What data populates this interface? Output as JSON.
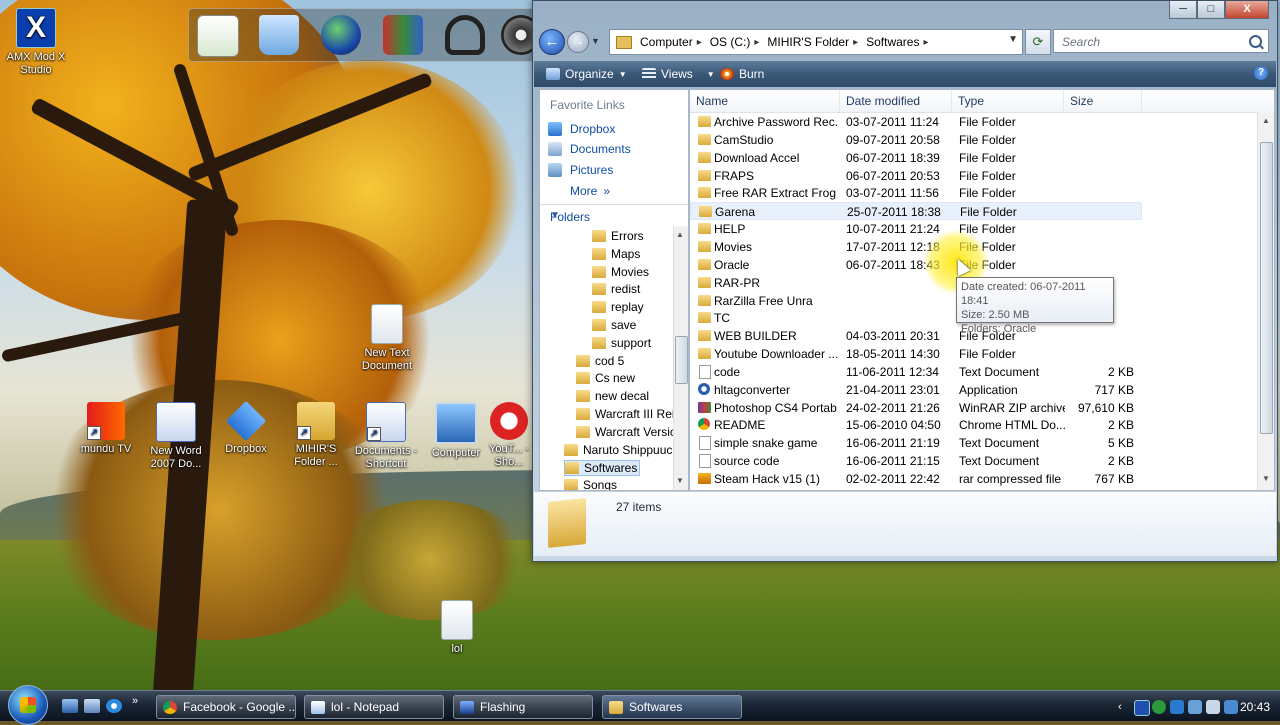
{
  "desktop": {
    "icons": [
      {
        "id": "amx",
        "label": "AMX Mod X Studio",
        "icon": "amx-icon"
      },
      {
        "id": "newtext",
        "label": "New Text Document",
        "icon": "text-file-icon"
      },
      {
        "id": "mundu",
        "label": "mundu TV",
        "icon": "mundu-icon"
      },
      {
        "id": "word",
        "label": "New Word 2007 Do...",
        "icon": "word-doc-icon"
      },
      {
        "id": "dropbox",
        "label": "Dropbox",
        "icon": "dropbox-icon"
      },
      {
        "id": "mihir",
        "label": "MIHIR'S Folder ...",
        "icon": "folder-shortcut-icon"
      },
      {
        "id": "docs",
        "label": "Documents - Shortcut",
        "icon": "documents-shortcut-icon"
      },
      {
        "id": "computer",
        "label": "Computer",
        "icon": "computer-icon"
      },
      {
        "id": "youtube",
        "label": "YouT... - Sho...",
        "icon": "youtube-shortcut-icon"
      },
      {
        "id": "lol",
        "label": "lol",
        "icon": "text-file-icon"
      }
    ]
  },
  "window": {
    "controls": {
      "minimize": "─",
      "maximize": "□",
      "close": "X"
    },
    "nav": {
      "back": "←",
      "forward": "→"
    },
    "breadcrumbs": [
      "Computer",
      "OS (C:)",
      "MIHIR'S Folder",
      "Softwares"
    ],
    "search_placeholder": "Search",
    "toolbar": {
      "organize": "Organize",
      "views": "Views",
      "burn": "Burn",
      "help": "?"
    },
    "favorites": {
      "title": "Favorite Links",
      "items": [
        {
          "label": "Dropbox",
          "icon": "dropbox-icon"
        },
        {
          "label": "Documents",
          "icon": "documents-icon"
        },
        {
          "label": "Pictures",
          "icon": "pictures-icon"
        },
        {
          "label": "More",
          "icon": "more-chevron-icon"
        }
      ]
    },
    "folders_header": "Folders",
    "tree": [
      {
        "label": "Errors",
        "level": 3
      },
      {
        "label": "Maps",
        "level": 3
      },
      {
        "label": "Movies",
        "level": 3
      },
      {
        "label": "redist",
        "level": 3
      },
      {
        "label": "replay",
        "level": 3
      },
      {
        "label": "save",
        "level": 3
      },
      {
        "label": "support",
        "level": 3
      },
      {
        "label": "cod 5",
        "level": 2
      },
      {
        "label": "Cs new",
        "level": 2
      },
      {
        "label": "new decal",
        "level": 2
      },
      {
        "label": "Warcraft III Rei",
        "level": 2
      },
      {
        "label": "Warcraft Versic",
        "level": 2
      },
      {
        "label": "Naruto Shippuuc",
        "level": 1
      },
      {
        "label": "Softwares",
        "level": 1,
        "selected": true
      },
      {
        "label": "Songs",
        "level": 1
      }
    ],
    "columns": {
      "name": "Name",
      "date": "Date modified",
      "type": "Type",
      "size": "Size"
    },
    "files": [
      {
        "name": "Archive Password Rec...",
        "date": "03-07-2011 11:24",
        "type": "File Folder",
        "size": "",
        "icon": "folder"
      },
      {
        "name": "CamStudio",
        "date": "09-07-2011 20:58",
        "type": "File Folder",
        "size": "",
        "icon": "folder"
      },
      {
        "name": "Download Accel",
        "date": "06-07-2011 18:39",
        "type": "File Folder",
        "size": "",
        "icon": "folder"
      },
      {
        "name": "FRAPS",
        "date": "06-07-2011 20:53",
        "type": "File Folder",
        "size": "",
        "icon": "folder"
      },
      {
        "name": "Free RAR Extract Frog",
        "date": "03-07-2011 11:56",
        "type": "File Folder",
        "size": "",
        "icon": "folder"
      },
      {
        "name": "Garena",
        "date": "25-07-2011 18:38",
        "type": "File Folder",
        "size": "",
        "icon": "folder",
        "hover": true
      },
      {
        "name": "HELP",
        "date": "10-07-2011 21:24",
        "type": "File Folder",
        "size": "",
        "icon": "folder"
      },
      {
        "name": "Movies",
        "date": "17-07-2011 12:18",
        "type": "File Folder",
        "size": "",
        "icon": "folder"
      },
      {
        "name": "Oracle",
        "date": "06-07-2011 18:43",
        "type": "File Folder",
        "size": "",
        "icon": "folder"
      },
      {
        "name": "RAR-PR",
        "date": "",
        "type": "File Folder",
        "size": "",
        "icon": "folder"
      },
      {
        "name": "RarZilla Free Unra",
        "date": "",
        "type": "File Folder",
        "size": "",
        "icon": "folder"
      },
      {
        "name": "TC",
        "date": "",
        "type": "File Folder",
        "size": "",
        "icon": "folder"
      },
      {
        "name": "WEB BUILDER",
        "date": "04-03-2011 20:31",
        "type": "File Folder",
        "size": "",
        "icon": "folder"
      },
      {
        "name": "Youtube Downloader ...",
        "date": "18-05-2011 14:30",
        "type": "File Folder",
        "size": "",
        "icon": "folder"
      },
      {
        "name": "code",
        "date": "11-06-2011 12:34",
        "type": "Text Document",
        "size": "2 KB",
        "icon": "text"
      },
      {
        "name": "hltagconverter",
        "date": "21-04-2011 23:01",
        "type": "Application",
        "size": "717 KB",
        "icon": "app"
      },
      {
        "name": "Photoshop CS4 Portab...",
        "date": "24-02-2011 21:26",
        "type": "WinRAR ZIP archive",
        "size": "97,610 KB",
        "icon": "winrar"
      },
      {
        "name": "README",
        "date": "15-06-2010 04:50",
        "type": "Chrome HTML Do...",
        "size": "2 KB",
        "icon": "chrome"
      },
      {
        "name": "simple snake game",
        "date": "16-06-2011 21:19",
        "type": "Text Document",
        "size": "5 KB",
        "icon": "text"
      },
      {
        "name": "source code",
        "date": "16-06-2011 21:15",
        "type": "Text Document",
        "size": "2 KB",
        "icon": "text"
      },
      {
        "name": "Steam Hack v15 (1)",
        "date": "02-02-2011 22:42",
        "type": "rar compressed file",
        "size": "767 KB",
        "icon": "rar"
      }
    ],
    "tooltip": [
      "Date created: 06-07-2011 18:41",
      "Size: 2.50 MB",
      "Folders: Oracle"
    ],
    "details": {
      "count": "27 items"
    }
  },
  "taskbar": {
    "buttons": [
      {
        "label": "Facebook - Google ...",
        "icon": "chrome-icon",
        "active": false
      },
      {
        "label": "lol - Notepad",
        "icon": "notepad-icon",
        "active": false
      },
      {
        "label": "Flashing",
        "icon": "app-icon",
        "active": false
      },
      {
        "label": "Softwares",
        "icon": "folder-icon",
        "active": true
      }
    ],
    "clock": "20:43"
  },
  "colors": {
    "link_blue": "#0f4ea2",
    "toolbar_dark": "#2e4a68",
    "folder_yellow": "#e3c05a",
    "taskbar_dark": "#0b1420"
  }
}
